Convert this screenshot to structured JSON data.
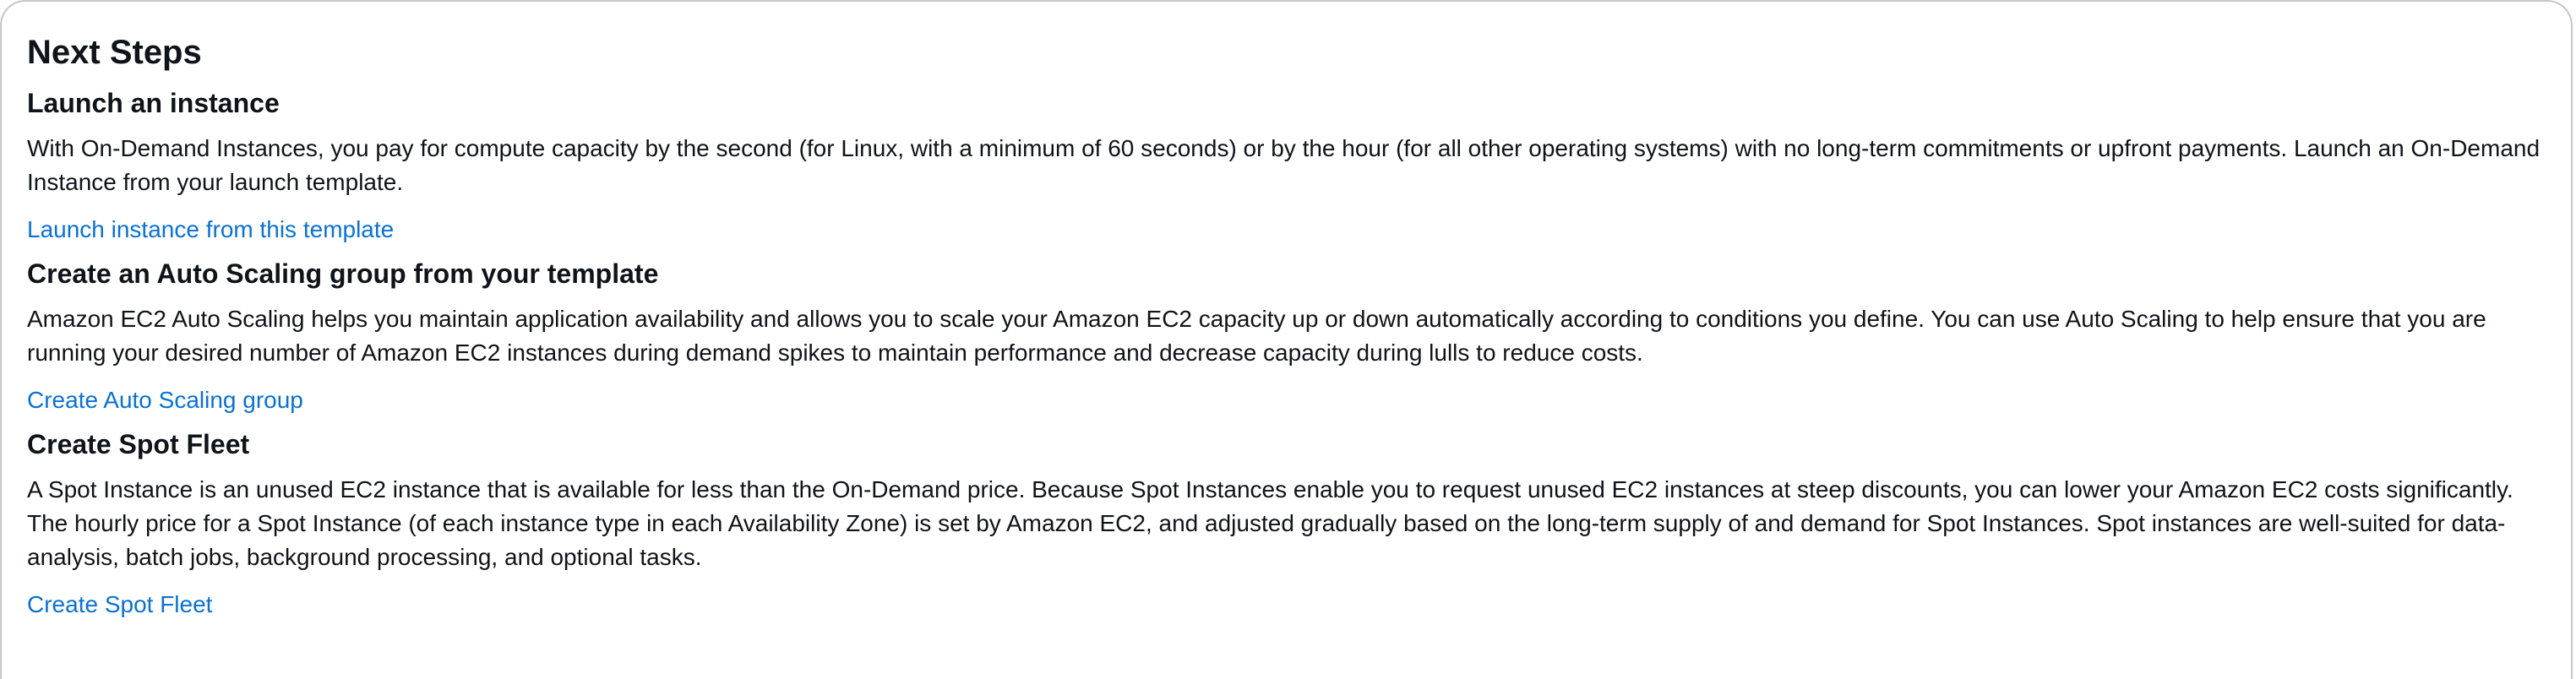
{
  "panel": {
    "title": "Next Steps"
  },
  "sections": [
    {
      "title": "Launch an instance",
      "description": "With On-Demand Instances, you pay for compute capacity by the second (for Linux, with a minimum of 60 seconds) or by the hour (for all other operating systems) with no long-term commitments or upfront payments. Launch an On-Demand Instance from your launch template.",
      "link": "Launch instance from this template"
    },
    {
      "title": "Create an Auto Scaling group from your template",
      "description": "Amazon EC2 Auto Scaling helps you maintain application availability and allows you to scale your Amazon EC2 capacity up or down automatically according to conditions you define. You can use Auto Scaling to help ensure that you are running your desired number of Amazon EC2 instances during demand spikes to maintain performance and decrease capacity during lulls to reduce costs.",
      "link": "Create Auto Scaling group"
    },
    {
      "title": "Create Spot Fleet",
      "description": "A Spot Instance is an unused EC2 instance that is available for less than the On-Demand price. Because Spot Instances enable you to request unused EC2 instances at steep discounts, you can lower your Amazon EC2 costs significantly. The hourly price for a Spot Instance (of each instance type in each Availability Zone) is set by Amazon EC2, and adjusted gradually based on the long-term supply of and demand for Spot Instances. Spot instances are well-suited for data-analysis, batch jobs, background processing, and optional tasks.",
      "link": "Create Spot Fleet"
    }
  ],
  "colors": {
    "text": "#0f141a",
    "link": "#0972d3",
    "border": "#c6c6cd"
  }
}
